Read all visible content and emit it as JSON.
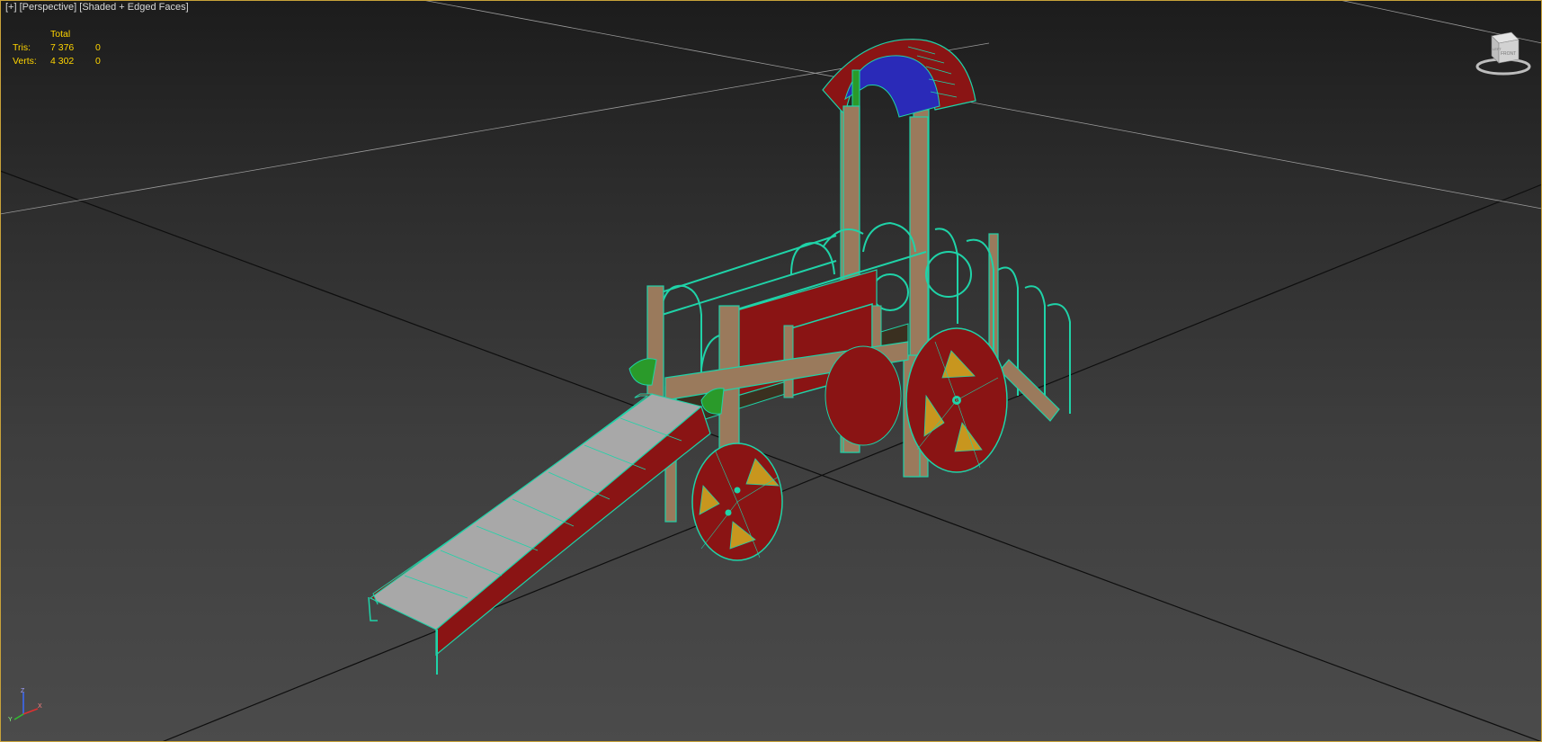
{
  "viewport": {
    "label_parts": {
      "plus": "[+]",
      "view": "[Perspective]",
      "shading": "[Shaded + Edged Faces]"
    },
    "border_color": "#c8a23a"
  },
  "statistics": {
    "column_header": "Total",
    "rows": [
      {
        "label": "Tris:",
        "total": "7 376",
        "selected": "0"
      },
      {
        "label": "Verts:",
        "total": "4 302",
        "selected": "0"
      }
    ],
    "text_color": "#ffd500"
  },
  "viewcube": {
    "icon": "viewcube-icon",
    "face_front": "FRONT",
    "face_left": "LEFT"
  },
  "axis_tripod": {
    "icon": "axis-tripod-icon",
    "x": "X",
    "y": "Y",
    "z": "Z"
  },
  "scene": {
    "object": "playground-train-model",
    "colors": {
      "wireframe": "#1fd3a8",
      "red": "#8a1414",
      "wood": "#9a7a5c",
      "roof_blue": "#2a2ab8",
      "slide_surface": "#a8a8a8",
      "wheel_insert": "#c8961e",
      "green_accent": "#2a9a2a"
    }
  }
}
